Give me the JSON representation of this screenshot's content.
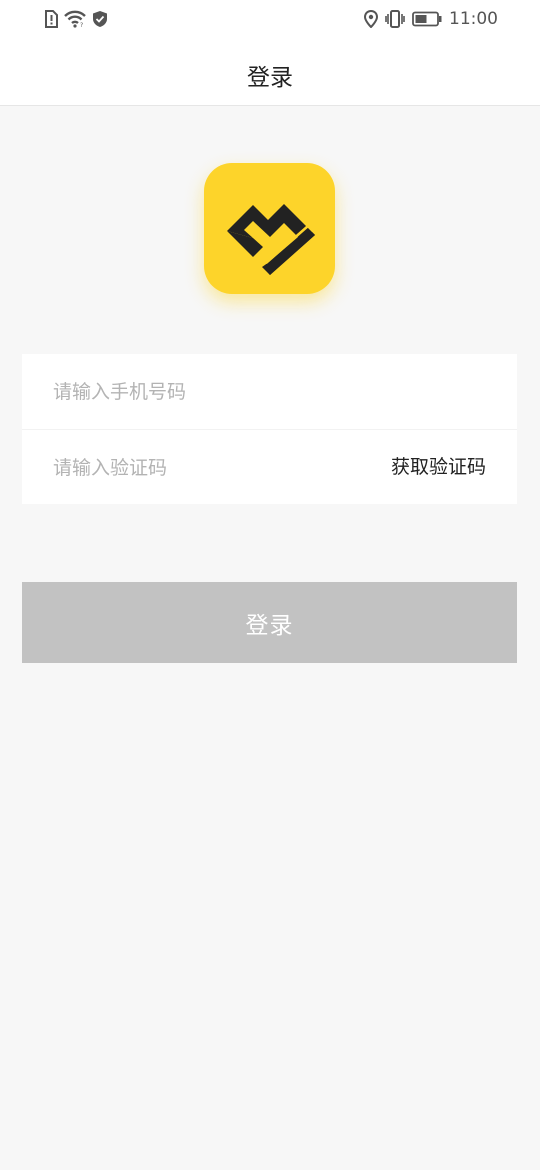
{
  "status_bar": {
    "time": "11:00",
    "icon_color": "#555555"
  },
  "header": {
    "title": "登录"
  },
  "logo": {
    "icon": "book-heart-logo-icon",
    "background": "#fdd42a"
  },
  "form": {
    "phone_placeholder": "请输入手机号码",
    "phone_value": "",
    "code_placeholder": "请输入验证码",
    "code_value": "",
    "get_code_label": "获取验证码"
  },
  "login_button": {
    "label": "登录",
    "background": "#c2c2c2"
  }
}
